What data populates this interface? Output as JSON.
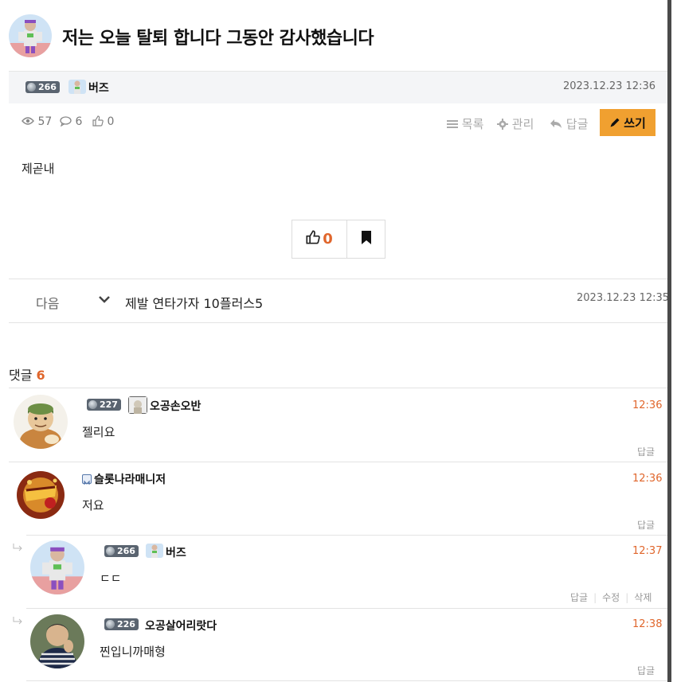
{
  "post": {
    "title": "저는 오늘 탈퇴 합니다 그동안 감사했습니다",
    "author": {
      "level": "266",
      "nickname": "버즈"
    },
    "date": "2023.12.23 12:36",
    "views": "57",
    "comments": "6",
    "likes": "0",
    "content": "제곧내"
  },
  "toolbar": {
    "list_label": "목록",
    "manage_label": "관리",
    "reply_label": "답글",
    "write_label": "쓰기"
  },
  "vote": {
    "count": "0"
  },
  "next_post": {
    "label": "다음",
    "title": "제발 연타가자 10플러스5",
    "date": "2023.12.23 12:35"
  },
  "comments_section": {
    "label": "댓글",
    "count": "6",
    "items": [
      {
        "level": "227",
        "nickname": "오공손오반",
        "time": "12:36",
        "text": "젤리요",
        "actions": [
          "답글"
        ]
      },
      {
        "level": "",
        "nickname": "슬롯나라매니저",
        "time": "12:36",
        "text": "저요",
        "actions": [
          "답글"
        ]
      },
      {
        "level": "266",
        "nickname": "버즈",
        "time": "12:37",
        "text": "ㄷㄷ",
        "actions": [
          "답글",
          "수정",
          "삭제"
        ]
      },
      {
        "level": "226",
        "nickname": "오공살어리랏다",
        "time": "12:38",
        "text": "찐입니까매형",
        "actions": [
          "답글"
        ]
      }
    ]
  },
  "icons": {
    "views": "eye-icon",
    "comments": "speech-bubble-icon",
    "likes": "thumbs-up-icon",
    "list": "menu-icon",
    "manage": "gear-icon",
    "reply": "reply-arrow-icon",
    "write": "pencil-icon",
    "bookmark": "bookmark-icon",
    "next": "chevron-down-icon"
  },
  "colors": {
    "accent": "#e0662c",
    "write_button": "#f0a030"
  }
}
